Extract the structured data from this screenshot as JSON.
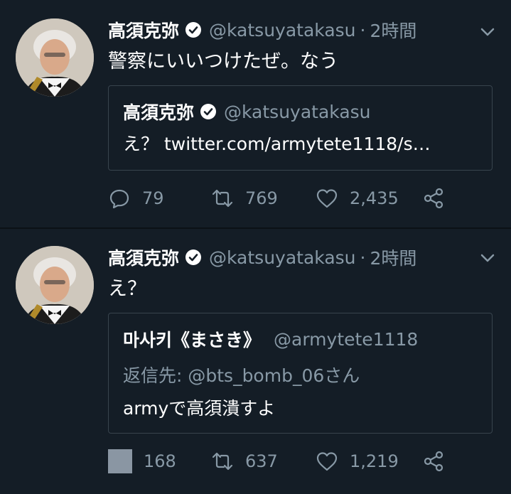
{
  "tweets": [
    {
      "author": {
        "name": "高須克弥",
        "handle": "@katsuyatakasu"
      },
      "time_sep": "·",
      "time": "2時間",
      "text": "警察にいいつけたぜ。なう",
      "quote": {
        "name": "高須克弥",
        "handle": "@katsuyatakasu",
        "text": "え？ twitter.com/armytete1118/s…"
      },
      "counts": {
        "reply": "79",
        "retweet": "769",
        "like": "2,435"
      }
    },
    {
      "author": {
        "name": "高須克弥",
        "handle": "@katsuyatakasu"
      },
      "time_sep": "·",
      "time": "2時間",
      "text": "え？",
      "quote": {
        "name": "마사키《まさき》",
        "handle": "@armytete1118",
        "reply_to": "返信先: @bts_bomb_06さん",
        "text": "armyで高須潰すよ"
      },
      "counts": {
        "reply": "168",
        "retweet": "637",
        "like": "1,219"
      }
    }
  ],
  "colors": {
    "background": "#141d26",
    "secondary_text": "#8899a6",
    "border": "#38444d"
  },
  "icons": [
    "verified-badge-icon",
    "chevron-down-icon",
    "reply-icon",
    "retweet-icon",
    "heart-icon",
    "share-icon"
  ]
}
